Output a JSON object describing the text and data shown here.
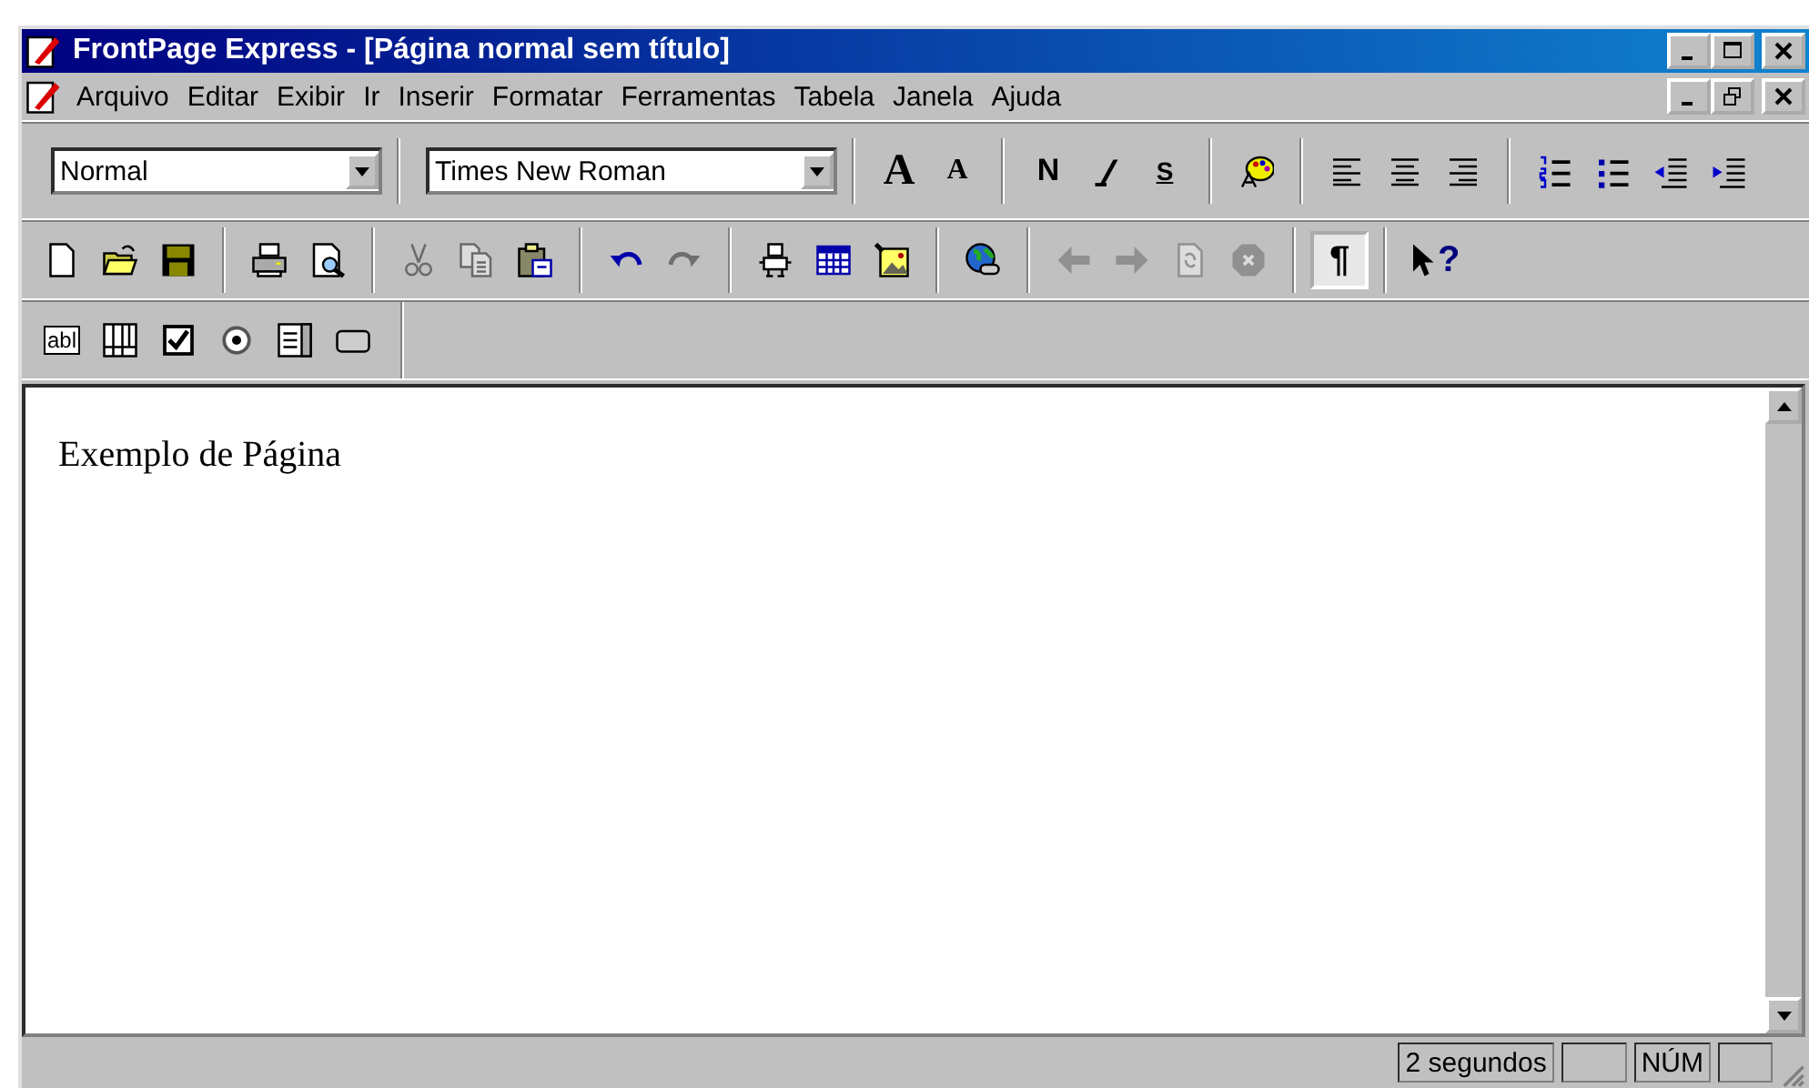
{
  "window": {
    "title": "FrontPage Express - [Página normal sem título]"
  },
  "menu": [
    {
      "label": "Arquivo"
    },
    {
      "label": "Editar"
    },
    {
      "label": "Exibir"
    },
    {
      "label": "Ir"
    },
    {
      "label": "Inserir"
    },
    {
      "label": "Formatar"
    },
    {
      "label": "Ferramentas"
    },
    {
      "label": "Tabela"
    },
    {
      "label": "Janela"
    },
    {
      "label": "Ajuda"
    }
  ],
  "format_toolbar": {
    "style": "Normal",
    "font": "Times New Roman",
    "groups": [
      [
        {
          "kind": "grow",
          "label": "A"
        },
        {
          "kind": "shrink",
          "label": "A"
        }
      ],
      [
        {
          "kind": "bold",
          "label": "N"
        },
        {
          "kind": "italic"
        },
        {
          "kind": "underline",
          "label": "S"
        }
      ],
      [
        {
          "kind": "palette"
        }
      ],
      [
        {
          "kind": "align-left"
        },
        {
          "kind": "align-center"
        },
        {
          "kind": "align-right"
        }
      ],
      [
        {
          "kind": "numbered"
        },
        {
          "kind": "bulleted"
        },
        {
          "kind": "outdent"
        },
        {
          "kind": "indent"
        }
      ]
    ]
  },
  "standard_toolbar": {
    "groups": [
      [
        {
          "kind": "page",
          "disabled": false,
          "pressed": false
        },
        {
          "kind": "folder",
          "disabled": false,
          "pressed": false
        },
        {
          "kind": "floppy",
          "disabled": false,
          "pressed": false
        }
      ],
      [
        {
          "kind": "printer",
          "disabled": false,
          "pressed": false
        },
        {
          "kind": "preview",
          "disabled": false,
          "pressed": false
        }
      ],
      [
        {
          "kind": "scissors",
          "disabled": true,
          "pressed": false
        },
        {
          "kind": "copy",
          "disabled": true,
          "pressed": false
        },
        {
          "kind": "clipboard",
          "disabled": false,
          "pressed": false
        }
      ],
      [
        {
          "kind": "undo",
          "disabled": false,
          "pressed": false
        },
        {
          "kind": "redo",
          "disabled": true,
          "pressed": false
        }
      ],
      [
        {
          "kind": "robot",
          "disabled": false,
          "pressed": false
        },
        {
          "kind": "table",
          "disabled": false,
          "pressed": false
        },
        {
          "kind": "image",
          "disabled": false,
          "pressed": false
        }
      ],
      [
        {
          "kind": "globe",
          "disabled": false,
          "pressed": false
        }
      ],
      [
        {
          "kind": "back",
          "disabled": true,
          "pressed": false
        },
        {
          "kind": "forward",
          "disabled": true,
          "pressed": false
        },
        {
          "kind": "refresh",
          "disabled": true,
          "pressed": false
        },
        {
          "kind": "stop",
          "disabled": true,
          "pressed": false
        }
      ],
      [
        {
          "kind": "pilcrow",
          "label": "¶",
          "disabled": false,
          "pressed": true
        }
      ],
      [
        {
          "kind": "help",
          "label": "?",
          "disabled": false,
          "pressed": false
        }
      ]
    ]
  },
  "forms_toolbar": [
    {
      "kind": "textbox",
      "label": "abl"
    },
    {
      "kind": "listgrid"
    },
    {
      "kind": "checkbox"
    },
    {
      "kind": "radio"
    },
    {
      "kind": "dropdown"
    },
    {
      "kind": "pushbutton"
    }
  ],
  "editor": {
    "text": "Exemplo de Página"
  },
  "status_bar": {
    "time": "2 segundos",
    "num": "NÚM"
  }
}
